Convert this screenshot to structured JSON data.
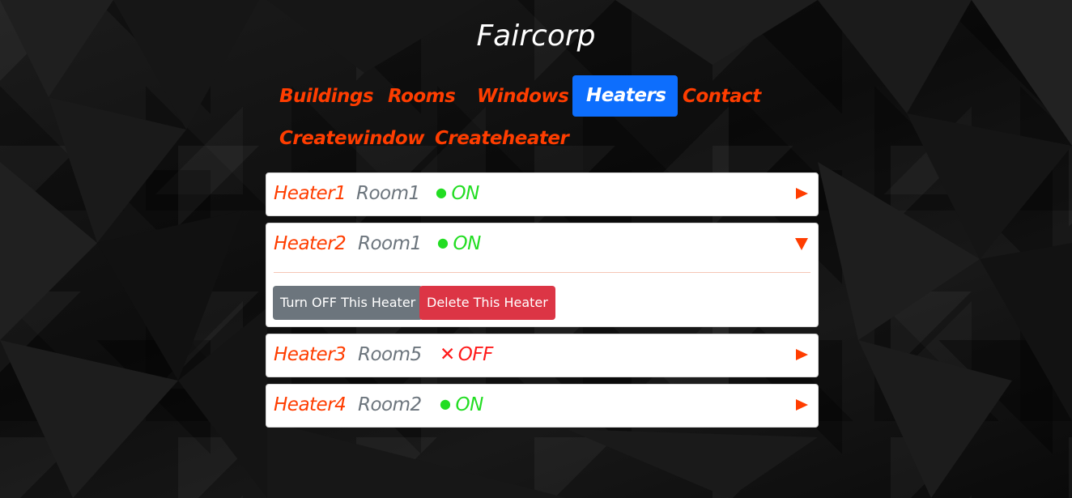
{
  "header": {
    "title": "Faircorp"
  },
  "nav": {
    "items": [
      {
        "label": "Buildings"
      },
      {
        "label": "Rooms"
      },
      {
        "label": "Windows"
      },
      {
        "label": "Heaters",
        "active": true
      },
      {
        "label": "Contact"
      },
      {
        "label": "Createwindow"
      },
      {
        "label": "Createheater"
      }
    ]
  },
  "heaters": [
    {
      "name": "Heater1",
      "room": "Room1",
      "status": "ON",
      "expanded": false
    },
    {
      "name": "Heater2",
      "room": "Room1",
      "status": "ON",
      "expanded": true,
      "actions": {
        "toggle_label": "Turn OFF This Heater",
        "delete_label": "Delete This Heater"
      }
    },
    {
      "name": "Heater3",
      "room": "Room5",
      "status": "OFF",
      "expanded": false
    },
    {
      "name": "Heater4",
      "room": "Room2",
      "status": "ON",
      "expanded": false
    }
  ],
  "icons": {
    "status_on": "green-dot-icon",
    "status_off": "red-cross-icon",
    "collapsed": "triangle-right-icon",
    "expanded": "triangle-down-icon"
  },
  "colors": {
    "accent": "#ff3d00",
    "active_nav": "#0d6efd",
    "on": "#22dd22",
    "off": "#ff1a1a",
    "room": "#6c757d",
    "delete": "#dc3545",
    "secondary": "#6c757d"
  }
}
